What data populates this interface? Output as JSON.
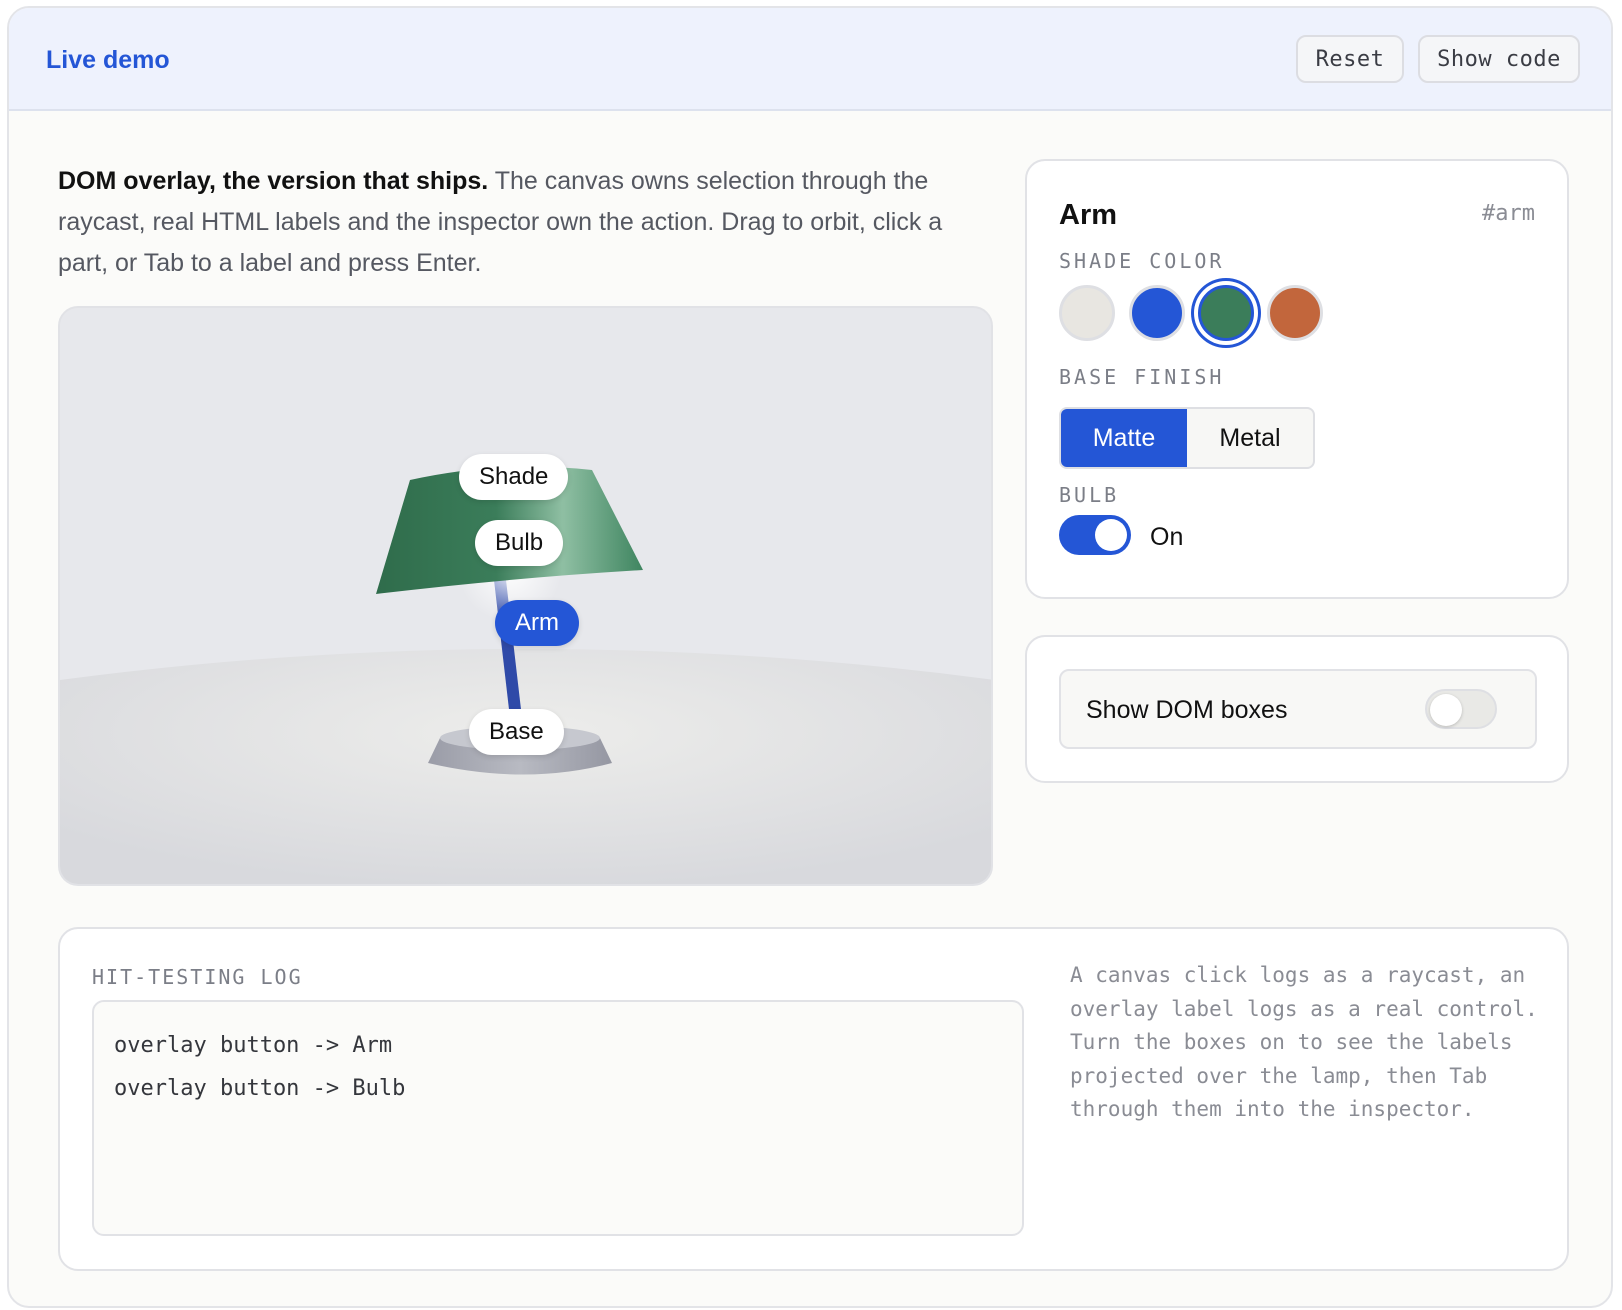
{
  "topbar": {
    "title": "Live demo",
    "reset_label": "Reset",
    "show_code_label": "Show code"
  },
  "intro": {
    "lead": "DOM overlay, the version that ships.",
    "body": "The canvas owns selection through the raycast, real HTML labels and the inspector own the action. Drag to orbit, click a part, or Tab to a label and press Enter."
  },
  "scene": {
    "labels": {
      "shade": "Shade",
      "bulb": "Bulb",
      "arm": "Arm",
      "base": "Base"
    },
    "selected_part": "Arm",
    "colors": {
      "shade": "#3b7d5a",
      "arm": "#2f4aa8",
      "base": "#a9abb5",
      "background": "#e6e7eb",
      "floor": "#dcdde1"
    }
  },
  "inspector": {
    "heading": "Arm",
    "id_tag": "#arm",
    "shade_color_label": "SHADE COLOR",
    "swatches": [
      "#e8e6e1",
      "#2456d6",
      "#3b7d5a",
      "#c2663c"
    ],
    "selected_swatch": "#3b7d5a",
    "base_finish_label": "BASE FINISH",
    "finish_options": [
      "Matte",
      "Metal"
    ],
    "finish_selected": "Matte",
    "bulb_label": "BULB",
    "bulb_state": "On",
    "bulb_on": true
  },
  "dom_boxes": {
    "label": "Show DOM boxes",
    "enabled": false
  },
  "log": {
    "caption": "HIT-TESTING LOG",
    "entries": [
      "overlay button -> Arm",
      "overlay button -> Bulb"
    ],
    "note": "A canvas click logs as a raycast, an overlay label logs as a real control. Turn the boxes on to see the labels projected over the lamp, then Tab through them into the inspector."
  },
  "accent": "#2456d6"
}
